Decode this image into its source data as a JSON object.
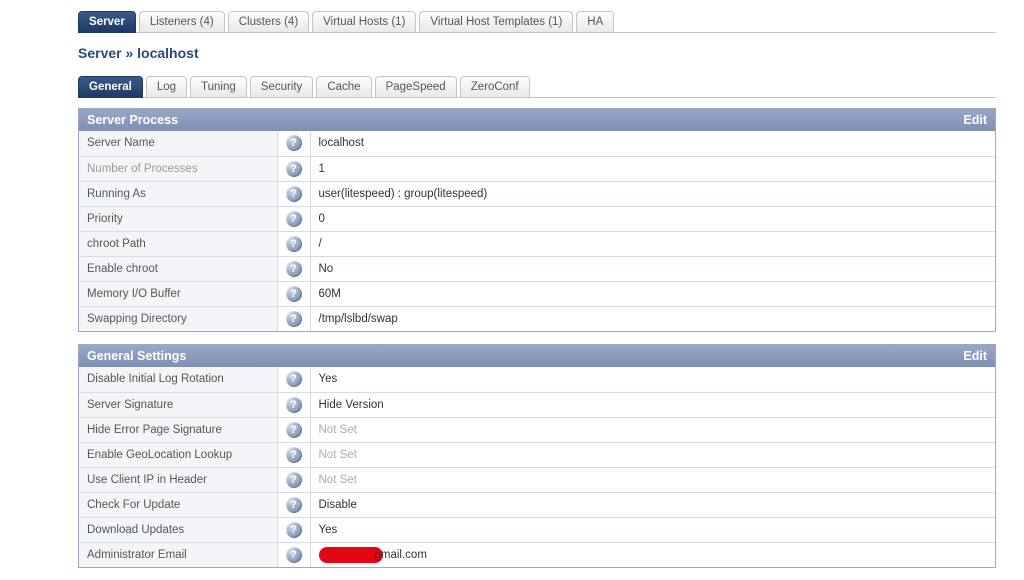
{
  "topTabs": [
    {
      "label": "Server",
      "active": true
    },
    {
      "label": "Listeners (4)",
      "active": false
    },
    {
      "label": "Clusters (4)",
      "active": false
    },
    {
      "label": "Virtual Hosts (1)",
      "active": false
    },
    {
      "label": "Virtual Host Templates (1)",
      "active": false
    },
    {
      "label": "HA",
      "active": false
    }
  ],
  "breadcrumb": "Server » localhost",
  "subTabs": [
    {
      "label": "General",
      "active": true
    },
    {
      "label": "Log",
      "active": false
    },
    {
      "label": "Tuning",
      "active": false
    },
    {
      "label": "Security",
      "active": false
    },
    {
      "label": "Cache",
      "active": false
    },
    {
      "label": "PageSpeed",
      "active": false
    },
    {
      "label": "ZeroConf",
      "active": false
    }
  ],
  "panels": [
    {
      "title": "Server Process",
      "editLabel": "Edit",
      "rows": [
        {
          "label": "Server Name",
          "value": "localhost",
          "gray": false
        },
        {
          "label": "Number of Processes",
          "value": "1",
          "gray": true
        },
        {
          "label": "Running As",
          "value": "user(litespeed) : group(litespeed)",
          "gray": false
        },
        {
          "label": "Priority",
          "value": "0",
          "gray": false
        },
        {
          "label": "chroot Path",
          "value": "/",
          "gray": false
        },
        {
          "label": "Enable chroot",
          "value": "No",
          "gray": false
        },
        {
          "label": "Memory I/O Buffer",
          "value": "60M",
          "gray": false
        },
        {
          "label": "Swapping Directory",
          "value": "/tmp/lslbd/swap",
          "gray": false
        }
      ]
    },
    {
      "title": "General Settings",
      "editLabel": "Edit",
      "rows": [
        {
          "label": "Disable Initial Log Rotation",
          "value": "Yes",
          "gray": false
        },
        {
          "label": "Server Signature",
          "value": "Hide Version",
          "gray": false
        },
        {
          "label": "Hide Error Page Signature",
          "value": "Not Set",
          "notset": true,
          "gray": false
        },
        {
          "label": "Enable GeoLocation Lookup",
          "value": "Not Set",
          "notset": true,
          "gray": false
        },
        {
          "label": "Use Client IP in Header",
          "value": "Not Set",
          "notset": true,
          "gray": false
        },
        {
          "label": "Check For Update",
          "value": "Disable",
          "gray": false
        },
        {
          "label": "Download Updates",
          "value": "Yes",
          "gray": false
        },
        {
          "label": "Administrator Email",
          "value": "gmail.com",
          "redacted": true,
          "gray": false
        }
      ]
    }
  ]
}
